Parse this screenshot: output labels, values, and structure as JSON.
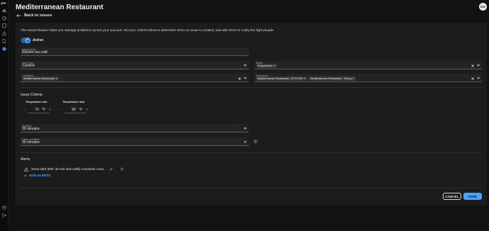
{
  "app": {
    "logo": "ZPP"
  },
  "header": {
    "title": "Mediterranean Restaurant",
    "avatar_initials": "GA"
  },
  "nav": {
    "back_label": "Back to issues",
    "rail_icons": [
      "home-icon",
      "dashboard-icon",
      "layers-icon",
      "warning-icon",
      "document-icon",
      "issues-icon",
      "help-icon",
      "logout-icon"
    ]
  },
  "intro": "The Issues feature helps you manage problems across your account. Set your criteria below to determine when an issue is created, and add Alerts to notify the right people.",
  "active_toggle": {
    "label": "Active",
    "checked": true
  },
  "fields": {
    "issue_name": {
      "label": "Issue name",
      "value": "Kitchen too cold"
    },
    "issue_type": {
      "label": "Issue type",
      "value": "Comfort"
    },
    "metric": {
      "label": "Metric",
      "chips": [
        "Temperature"
      ]
    },
    "locations": {
      "label": "Locations",
      "chips": [
        "Mediterranean Restaurant"
      ]
    },
    "equipment": {
      "label": "Equipment",
      "chips": [
        "Mediterranean Restaurant - KITCHEN",
        "Mediterranean Restaurant - Dining"
      ]
    }
  },
  "criteria": {
    "title": "Issue Criteria",
    "temp_min": {
      "label": "Temperature min",
      "value": "70",
      "unit": "°F",
      "minus": "−",
      "plus": "+"
    },
    "temp_max": {
      "label": "Temperature max",
      "value": "80",
      "unit": "°F",
      "minus": "−",
      "plus": "+"
    },
    "duration": {
      "label": "Duration",
      "value": "30 minutes"
    },
    "close_condition": {
      "label": "Close condition",
      "value": "30 minutes"
    }
  },
  "alerts": {
    "title": "Alerts",
    "items": [
      {
        "text": "Send alert after 30 min and notify Leonardo Lecci"
      }
    ],
    "add_label": "ADD ALERTS"
  },
  "actions": {
    "cancel": "CANCEL",
    "save": "SAVE"
  },
  "colors": {
    "accent": "#4aa3ff",
    "background": "#121212",
    "card": "#1c1c1c",
    "warning": "#e0a93b"
  }
}
